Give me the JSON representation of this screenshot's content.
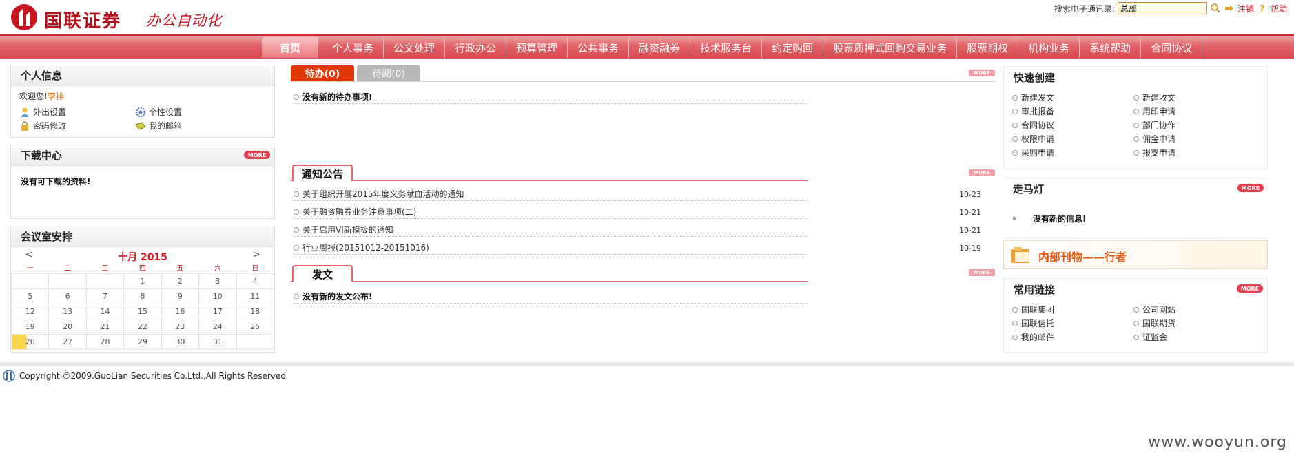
{
  "header": {
    "logo_text": "国联证券",
    "subtitle": "办公自动化",
    "search_label": "搜索电子通讯录:",
    "search_value": "总部",
    "logout": "注销",
    "help": "帮助"
  },
  "nav": [
    "首页",
    "个人事务",
    "公文处理",
    "行政办公",
    "预算管理",
    "公共事务",
    "融资融券",
    "技术服务台",
    "约定购回",
    "股票质押式回购交易业务",
    "股票期权",
    "机构业务",
    "系统帮助",
    "合同协议"
  ],
  "personal": {
    "title": "个人信息",
    "welcome": "欢迎您!",
    "user": "李排",
    "items": [
      "外出设置",
      "个性设置",
      "密码修改",
      "我的邮箱"
    ]
  },
  "downloads": {
    "title": "下载中心",
    "more": "MORE",
    "empty": "没有可下载的资料!"
  },
  "meeting": {
    "title": "会议室安排",
    "month": "十月 2015",
    "prev": "<",
    "next": ">",
    "weekdays": [
      "一",
      "二",
      "三",
      "四",
      "五",
      "六",
      "日"
    ],
    "weeks": [
      [
        "",
        "",
        "",
        "1",
        "2",
        "3",
        "4"
      ],
      [
        "5",
        "6",
        "7",
        "8",
        "9",
        "10",
        "11"
      ],
      [
        "12",
        "13",
        "14",
        "15",
        "16",
        "17",
        "18"
      ],
      [
        "19",
        "20",
        "21",
        "22",
        "23",
        "24",
        "25"
      ],
      [
        "26",
        "27",
        "28",
        "29",
        "30",
        "31",
        ""
      ]
    ]
  },
  "tasks": {
    "tab_todo": "待办(0)",
    "tab_toread": "待阅(0)",
    "more": "MORE",
    "empty": "没有新的待办事项!"
  },
  "notice": {
    "title": "通知公告",
    "more": "MORE",
    "items": [
      {
        "text": "关于组织开展2015年度义务献血活动的通知",
        "date": "10-23"
      },
      {
        "text": "关于融资融券业务注意事项(二)",
        "date": "10-21"
      },
      {
        "text": "关于启用VI新模板的通知",
        "date": "10-21"
      },
      {
        "text": "行业周报(20151012-20151016)",
        "date": "10-19"
      }
    ]
  },
  "docs": {
    "title": "发文",
    "more": "MORE",
    "empty": "没有新的发文公布!"
  },
  "quick": {
    "title": "快速创建",
    "items": [
      "新建发文",
      "新建收文",
      "审批报备",
      "用印申请",
      "合同协议",
      "部门协作",
      "权限申请",
      "佣金申请",
      "采购申请",
      "报支申请"
    ]
  },
  "marquee": {
    "title": "走马灯",
    "more": "MORE",
    "empty": "没有新的信息!"
  },
  "banner": {
    "text": "内部刊物——行者"
  },
  "links": {
    "title": "常用链接",
    "more": "MORE",
    "items": [
      "国联集团",
      "公司网站",
      "国联信托",
      "国联期货",
      "我的邮件",
      "证监会"
    ]
  },
  "footer": {
    "copyright": "Copyright ©2009.GuoLian Securities Co.Ltd.,All Rights Reserved"
  },
  "watermark": "www.wooyun.org",
  "colors": {
    "brand": "#c8151e",
    "accent": "#de3a08",
    "nav": "#e06066"
  }
}
